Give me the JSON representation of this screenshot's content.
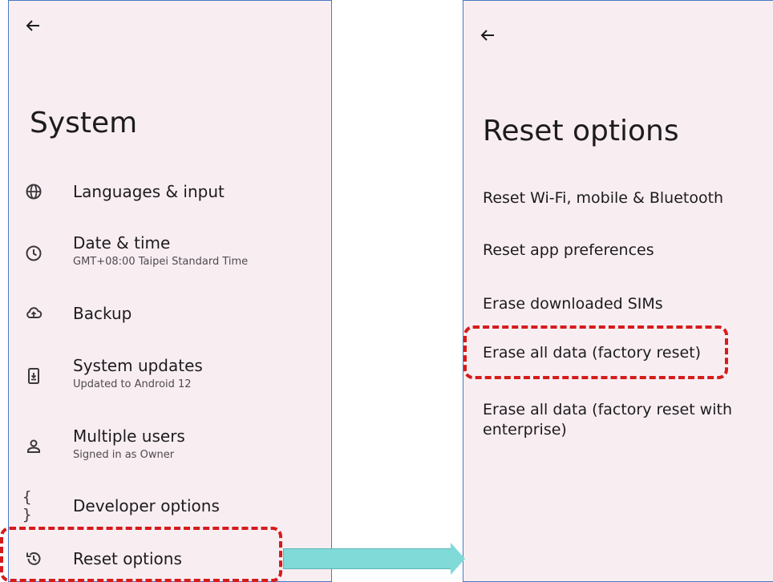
{
  "left_screen": {
    "title": "System",
    "items": [
      {
        "icon": "globe-icon",
        "title": "Languages & input",
        "subtitle": ""
      },
      {
        "icon": "clock-icon",
        "title": "Date & time",
        "subtitle": "GMT+08:00 Taipei Standard Time"
      },
      {
        "icon": "cloud-upload-icon",
        "title": "Backup",
        "subtitle": ""
      },
      {
        "icon": "system-update-icon",
        "title": "System updates",
        "subtitle": "Updated to Android 12"
      },
      {
        "icon": "person-icon",
        "title": "Multiple users",
        "subtitle": "Signed in as Owner"
      },
      {
        "icon": "braces-icon",
        "title": "Developer options",
        "subtitle": ""
      },
      {
        "icon": "history-icon",
        "title": "Reset options",
        "subtitle": ""
      }
    ]
  },
  "right_screen": {
    "title": "Reset options",
    "items": [
      {
        "label": "Reset Wi-Fi, mobile & Bluetooth"
      },
      {
        "label": "Reset app preferences"
      },
      {
        "label": "Erase downloaded SIMs"
      },
      {
        "label": "Erase all data (factory reset)"
      },
      {
        "label": "Erase all data (factory reset with enterprise)"
      }
    ]
  },
  "colors": {
    "panel_bg": "#f8eef2",
    "panel_border": "#4a78c5",
    "highlight": "#d61b1b",
    "arrow": "#7fdad8"
  }
}
